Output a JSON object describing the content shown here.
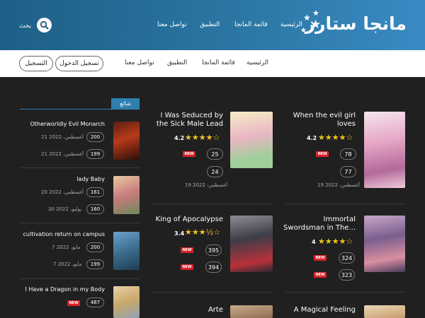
{
  "header": {
    "logo_text": "مانجا ستارز",
    "nav": {
      "home": "الرئيسية",
      "manga_list": "قائمة المانجا",
      "app": "التطبيق",
      "contact": "تواصل معنا"
    },
    "search_label": "بحث"
  },
  "subbar": {
    "register": "التسجيل",
    "login": "تسجيل الدخول",
    "contact": "تواصل معنا",
    "app": "التطبيق",
    "manga_list": "قائمة المانجا",
    "home": "الرئيسية"
  },
  "trending": {
    "tab_label": "شائع",
    "items": [
      {
        "title": "Otherworldly Evil Monarch",
        "ch1": "200",
        "d1": "21 أغسطس، 2022",
        "ch2": "199",
        "d2": "21 أغسطس، 2022"
      },
      {
        "title": "lady Baby",
        "ch1": "161",
        "d1": "20 أغسطس، 2022",
        "ch2": "160",
        "d2": "30 يوليو، 2022"
      },
      {
        "title": "cultivation return on campus",
        "ch1": "200",
        "d1": "7 مايو، 2022",
        "ch2": "199",
        "d2": "7 مايو، 2022"
      },
      {
        "title": "I Have a Dragon in my Body",
        "ch1": "487",
        "new1": "NEW"
      }
    ]
  },
  "cards": [
    {
      "title_l1": "When the evil girl",
      "title_l2": "loves",
      "rating": "4.2",
      "stars": "★★★★☆",
      "ch1": "78",
      "new1": "NEW",
      "ch2": "77",
      "date": "19 أغسطس، 2022"
    },
    {
      "title_l1": "I Was Seduced by",
      "title_l2": "the Sick Male Lead",
      "rating": "4.2",
      "stars": "★★★★☆",
      "ch1": "25",
      "new1": "NEW",
      "ch2": "24",
      "date": "19 أغسطس، 2022"
    },
    {
      "title_l1": "Immortal",
      "title_l2": "Swordsman in The...",
      "rating": "4",
      "stars": "★★★★☆",
      "ch1": "324",
      "new1": "NEW",
      "ch2": "323",
      "new2": "NEW"
    },
    {
      "title_l1": "King of Apocalypse",
      "rating": "3.4",
      "stars": "★★★½☆",
      "ch1": "395",
      "new1": "NEW",
      "ch2": "394",
      "new2": "NEW"
    },
    {
      "title_l1": "A Magical Feeling"
    },
    {
      "title_l1": "Arte"
    }
  ],
  "colors": {
    "header": "#2c78a6",
    "accent": "#2e7fb0",
    "star": "#f3c623",
    "new": "#d8232a"
  }
}
